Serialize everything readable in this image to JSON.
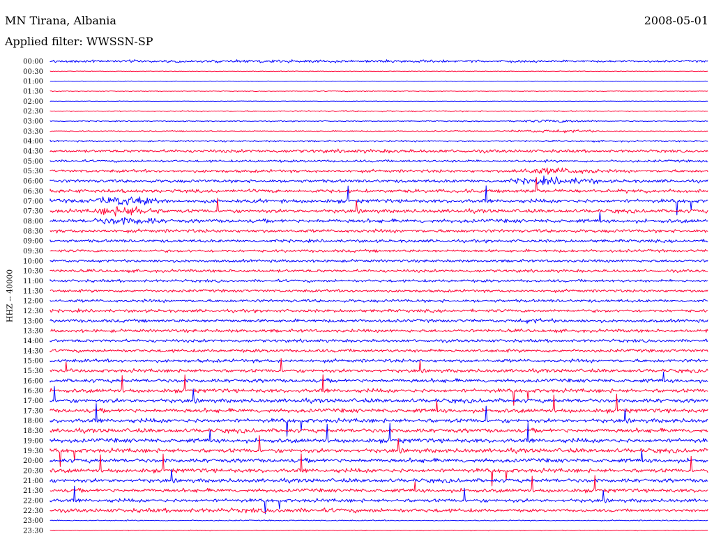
{
  "header": {
    "station": "MN Tirana, Albania",
    "date": "2008-05-01",
    "filter": "Applied filter: WWSSN-SP"
  },
  "colors": {
    "trace_a": "#0000ff",
    "trace_b": "#ff0033",
    "background": "#ffffff",
    "text": "#000000"
  },
  "chart_data": {
    "type": "line",
    "title": "MN Tirana, Albania",
    "subtitle": "Applied filter: WWSSN-SP",
    "ylabel": "HHZ -- 40000",
    "xlabel": "",
    "grid": false,
    "legend": "none",
    "time_labels": [
      "00:00",
      "00:30",
      "01:00",
      "01:30",
      "02:00",
      "02:30",
      "03:00",
      "03:30",
      "04:00",
      "04:30",
      "05:00",
      "05:30",
      "06:00",
      "06:30",
      "07:00",
      "07:30",
      "08:00",
      "08:30",
      "09:00",
      "09:30",
      "10:00",
      "10:30",
      "11:00",
      "11:30",
      "12:00",
      "12:30",
      "13:00",
      "13:30",
      "14:00",
      "14:30",
      "15:00",
      "15:30",
      "16:00",
      "16:30",
      "17:00",
      "17:30",
      "18:00",
      "18:30",
      "19:00",
      "19:30",
      "20:00",
      "20:30",
      "21:00",
      "21:30",
      "22:00",
      "22:30",
      "23:00",
      "23:30"
    ],
    "trace_amplitude": [
      0.55,
      0.18,
      0.15,
      0.2,
      0.15,
      0.14,
      0.28,
      0.3,
      0.45,
      0.5,
      0.65,
      0.8,
      0.85,
      0.95,
      1.0,
      1.0,
      1.0,
      0.9,
      0.8,
      0.75,
      0.75,
      0.78,
      0.75,
      0.75,
      0.8,
      0.82,
      0.85,
      0.85,
      0.82,
      0.85,
      0.9,
      0.95,
      1.0,
      1.05,
      1.1,
      1.1,
      1.12,
      1.12,
      1.15,
      1.15,
      1.1,
      1.1,
      1.05,
      1.0,
      0.95,
      0.8,
      0.3,
      0.25
    ],
    "bursts": [
      {
        "row": 0,
        "start_min": 0,
        "end_min": 22,
        "gain": 1.4
      },
      {
        "row": 3,
        "start_min": 12,
        "end_min": 17,
        "gain": 1.6
      },
      {
        "row": 4,
        "start_min": 1,
        "end_min": 2,
        "gain": 1.5
      },
      {
        "row": 5,
        "start_min": 0,
        "end_min": 30,
        "gain": 2.8
      },
      {
        "row": 9,
        "start_min": 0,
        "end_min": 30,
        "gain": 2.0
      },
      {
        "row": 14,
        "start_min": 2,
        "end_min": 5,
        "gain": 3.0
      },
      {
        "row": 15,
        "start_min": 2,
        "end_min": 5,
        "gain": 3.0
      },
      {
        "row": 16,
        "start_min": 2,
        "end_min": 5,
        "gain": 2.5
      },
      {
        "row": 6,
        "start_min": 21,
        "end_min": 25,
        "gain": 3.2
      },
      {
        "row": 7,
        "start_min": 21,
        "end_min": 25,
        "gain": 3.2
      },
      {
        "row": 11,
        "start_min": 21,
        "end_min": 25,
        "gain": 2.6
      },
      {
        "row": 12,
        "start_min": 21,
        "end_min": 25,
        "gain": 2.6
      },
      {
        "row": 26,
        "start_min": 21,
        "end_min": 23,
        "gain": 1.6
      },
      {
        "row": 45,
        "start_min": 0,
        "end_min": 20,
        "gain": 1.6
      }
    ]
  }
}
